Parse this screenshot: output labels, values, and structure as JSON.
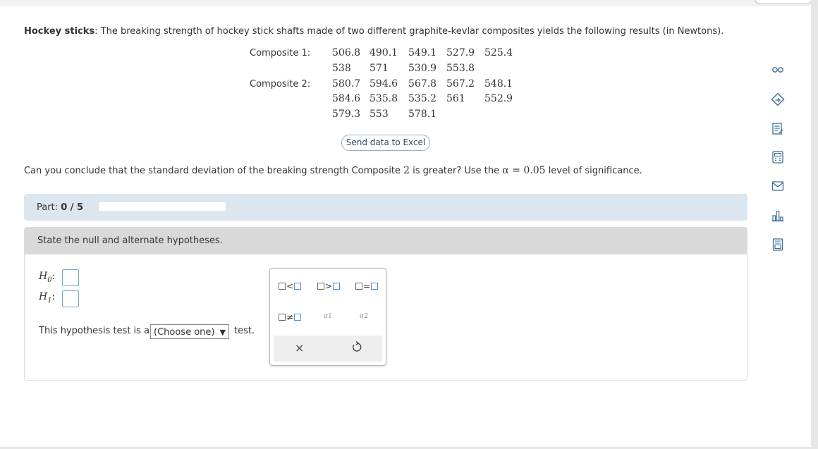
{
  "problem": {
    "title": "Hockey sticks",
    "text": ": The breaking strength of hockey stick shafts made of two different graphite-kevlar composites yields the following results (in Newtons)."
  },
  "composite1": {
    "label": "Composite 1:",
    "rows": [
      [
        "506.8",
        "490.1",
        "549.1",
        "527.9",
        "525.4"
      ],
      [
        "538",
        "571",
        "530.9",
        "553.8"
      ]
    ]
  },
  "composite2": {
    "label": "Composite 2:",
    "rows": [
      [
        "580.7",
        "594.6",
        "567.8",
        "567.2",
        "548.1"
      ],
      [
        "584.6",
        "535.8",
        "535.2",
        "561",
        "552.9"
      ],
      [
        "579.3",
        "553",
        "578.1"
      ]
    ]
  },
  "excel_button": "Send data to Excel",
  "question": {
    "before": "Can you conclude that the standard deviation of the breaking strength Composite ",
    "num": "2",
    "middle": " is greater? Use the ",
    "alpha": "α = 0.05",
    "after": " level of significance."
  },
  "part": {
    "label": "Part:",
    "value": "0 / 5",
    "progress": 0
  },
  "step": {
    "instruction": "State the null and alternate hypotheses."
  },
  "hypotheses": {
    "h0": "H",
    "h0_sub": "0",
    "h1": "H",
    "h1_sub": "1",
    "colon": ":"
  },
  "test_type": {
    "before": "This hypothesis test is a",
    "select": "(Choose one)",
    "after": "test."
  },
  "palette": {
    "less": "<",
    "greater": ">",
    "equal": "=",
    "notequal": "≠",
    "sigma1": "σ1",
    "sigma2": "σ2",
    "clear": "×"
  },
  "tools": [
    "glasses-icon",
    "hint-icon",
    "notes-icon",
    "calculator-icon",
    "mail-icon",
    "chart-icon",
    "tables-icon"
  ]
}
